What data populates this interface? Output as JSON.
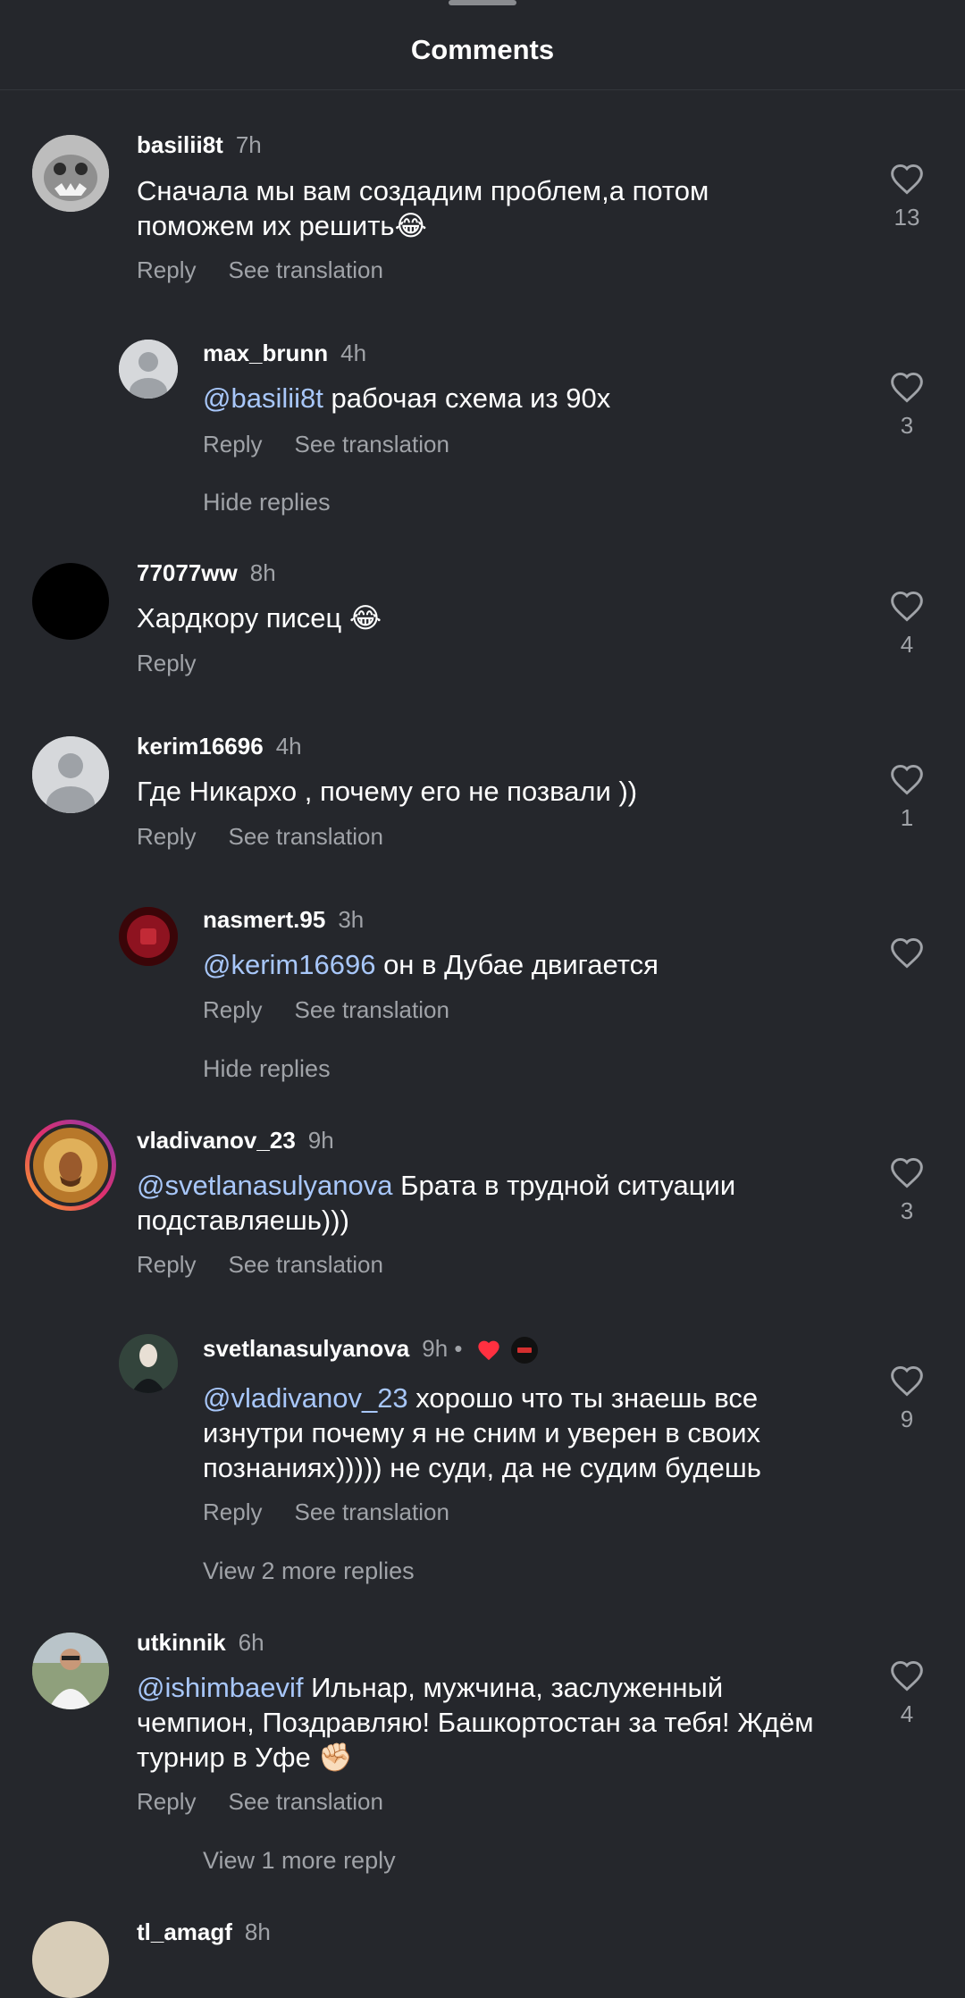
{
  "header": {
    "title": "Comments"
  },
  "labels": {
    "reply": "Reply",
    "see_translation": "See translation"
  },
  "comments": [
    {
      "username": "basilii8t",
      "time": "7h",
      "mention": "",
      "text": "Сначала мы вам создадим проблем,а потом поможем их решить😂",
      "likes": "13"
    },
    {
      "username": "max_brunn",
      "time": "4h",
      "mention": "@basilii8t",
      "text": " рабочая схема из 90х",
      "likes": "3"
    },
    {
      "username": "77077ww",
      "time": "8h",
      "mention": "",
      "text": "Хардкору писец 😂",
      "likes": "4"
    },
    {
      "username": "kerim16696",
      "time": "4h",
      "mention": "",
      "text": "Где Никархо , почему его не позвали ))",
      "likes": "1"
    },
    {
      "username": "nasmert.95",
      "time": "3h",
      "mention": "@kerim16696",
      "text": " он в Дубае двигается",
      "likes": ""
    },
    {
      "username": "vladivanov_23",
      "time": "9h",
      "mention": "@svetlanasulyanova",
      "text": " Брата в трудной ситуации подставляешь)))",
      "likes": "3"
    },
    {
      "username": "svetlanasulyanova",
      "time": "9h •",
      "mention": "@vladivanov_23",
      "text": " хорошо что ты знаешь все изнутри почему я не сним и уверен в своих познаниях))))) не суди, да не судим будешь",
      "likes": "9"
    },
    {
      "username": "utkinnik",
      "time": "6h",
      "mention": "@ishimbaevif",
      "text": " Ильнар, мужчина, заслуженный чемпион, Поздравляю! Башкортостан за тебя! Ждём турнир в Уфе ✊🏻",
      "likes": "4"
    },
    {
      "username": "tl_amagf",
      "time": "8h"
    }
  ],
  "toggles": {
    "hide_replies_1": "Hide replies",
    "hide_replies_2": "Hide replies",
    "view_more_1": "View 2 more replies",
    "view_more_2": "View 1 more reply"
  },
  "colors": {
    "background": "#25272c",
    "mention": "#a8c7fa",
    "muted": "#a0a3a8",
    "heart_red": "#ff3040"
  }
}
